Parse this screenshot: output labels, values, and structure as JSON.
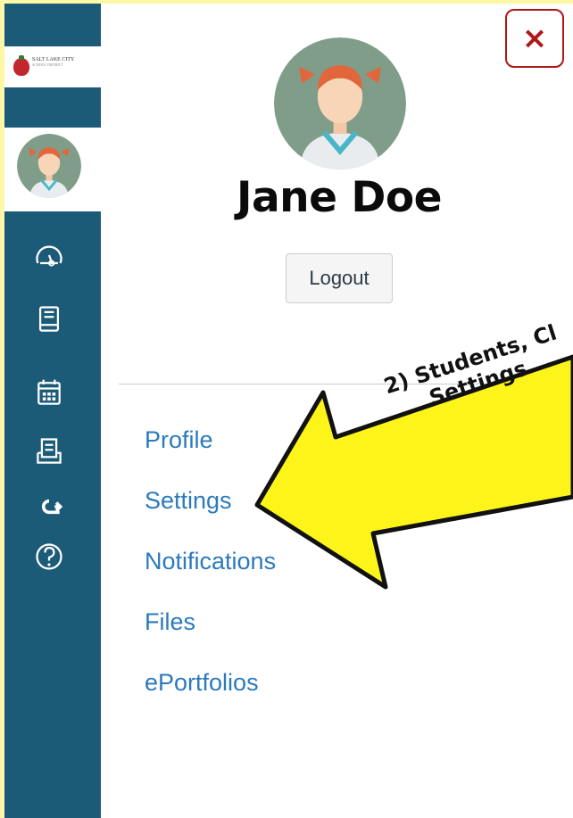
{
  "sidebar": {
    "brand": {
      "name": "SALT LAKE CITY",
      "subtitle": "SCHOOL DISTRICT"
    },
    "icons": [
      "dashboard-icon",
      "courses-icon",
      "calendar-icon",
      "inbox-icon",
      "commons-icon",
      "help-icon"
    ]
  },
  "tray": {
    "close_label": "×",
    "user_name": "Jane Doe",
    "logout_label": "Logout",
    "links": [
      "Profile",
      "Settings",
      "Notifications",
      "Files",
      "ePortfolios"
    ]
  },
  "callout": {
    "text": "2) Students, Cl\nSettings",
    "color": "#fdf51a"
  },
  "colors": {
    "sidebar": "#1c5b78",
    "link": "#2b7abc",
    "close": "#b01717",
    "frame": "#fef7a6"
  }
}
